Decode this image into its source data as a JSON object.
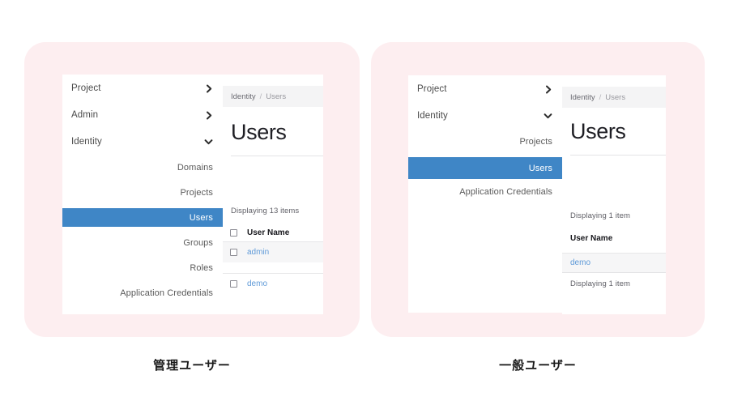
{
  "page": {
    "background": "#ffffff",
    "card_background": "#fdeef0",
    "accent_blue": "#3f86c6",
    "link_blue": "#5f9ad8",
    "breadcrumb_background": "#f4f4f5"
  },
  "admin_panel": {
    "caption": "管理ユーザー",
    "nav": {
      "top_items": [
        {
          "label": "Project",
          "icon": "chevron-right-icon",
          "expanded": false
        },
        {
          "label": "Admin",
          "icon": "chevron-right-icon",
          "expanded": false
        },
        {
          "label": "Identity",
          "icon": "chevron-down-icon",
          "expanded": true
        }
      ],
      "sub_items": [
        {
          "label": "Domains",
          "active": false
        },
        {
          "label": "Projects",
          "active": false
        },
        {
          "label": "Users",
          "active": true
        },
        {
          "label": "Groups",
          "active": false
        },
        {
          "label": "Roles",
          "active": false
        },
        {
          "label": "Application Credentials",
          "active": false
        }
      ]
    },
    "content": {
      "breadcrumb": {
        "root": "Identity",
        "separator": "/",
        "current": "Users"
      },
      "title": "Users",
      "displaying": "Displaying 13 items",
      "table": {
        "columns": [
          "User Name"
        ],
        "rows": [
          {
            "user_name": "admin",
            "shaded": true
          },
          {
            "user_name": "demo",
            "shaded": false
          }
        ]
      }
    }
  },
  "normal_panel": {
    "caption": "一般ユーザー",
    "nav": {
      "top_items": [
        {
          "label": "Project",
          "icon": "chevron-right-icon",
          "expanded": false
        },
        {
          "label": "Identity",
          "icon": "chevron-down-icon",
          "expanded": true
        }
      ],
      "sub_items": [
        {
          "label": "Projects",
          "active": false
        },
        {
          "label": "Users",
          "active": true
        },
        {
          "label": "Application Credentials",
          "active": false
        }
      ]
    },
    "content": {
      "breadcrumb": {
        "root": "Identity",
        "separator": "/",
        "current": "Users"
      },
      "title": "Users",
      "displaying_top": "Displaying 1 item",
      "displaying_bottom": "Displaying 1 item",
      "table": {
        "columns": [
          "User Name"
        ],
        "rows": [
          {
            "user_name": "demo",
            "shaded": true
          }
        ]
      }
    }
  }
}
